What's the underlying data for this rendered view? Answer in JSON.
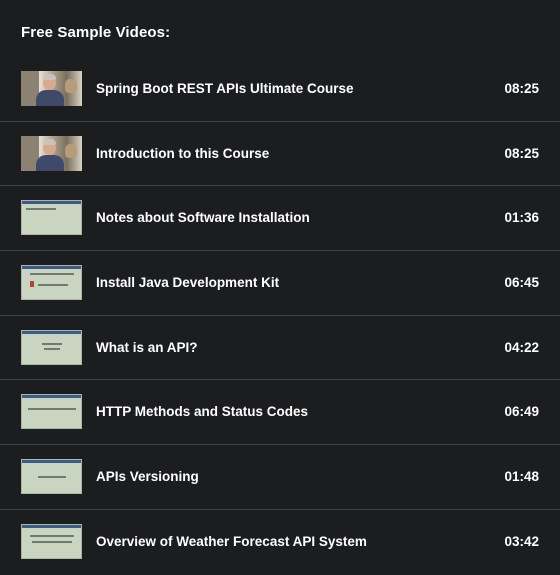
{
  "section": {
    "title": "Free Sample Videos:"
  },
  "videos": [
    {
      "title": "Spring Boot REST APIs Ultimate Course",
      "duration": "08:25",
      "thumbnail": "presenter-video"
    },
    {
      "title": "Introduction to this Course",
      "duration": "08:25",
      "thumbnail": "presenter-video"
    },
    {
      "title": "Notes about Software Installation",
      "duration": "01:36",
      "thumbnail": "slide"
    },
    {
      "title": "Install Java Development Kit",
      "duration": "06:45",
      "thumbnail": "slide"
    },
    {
      "title": "What is an API?",
      "duration": "04:22",
      "thumbnail": "slide"
    },
    {
      "title": "HTTP Methods and Status Codes",
      "duration": "06:49",
      "thumbnail": "slide"
    },
    {
      "title": "APIs Versioning",
      "duration": "01:48",
      "thumbnail": "slide"
    },
    {
      "title": "Overview of Weather Forecast API System",
      "duration": "03:42",
      "thumbnail": "slide"
    }
  ]
}
